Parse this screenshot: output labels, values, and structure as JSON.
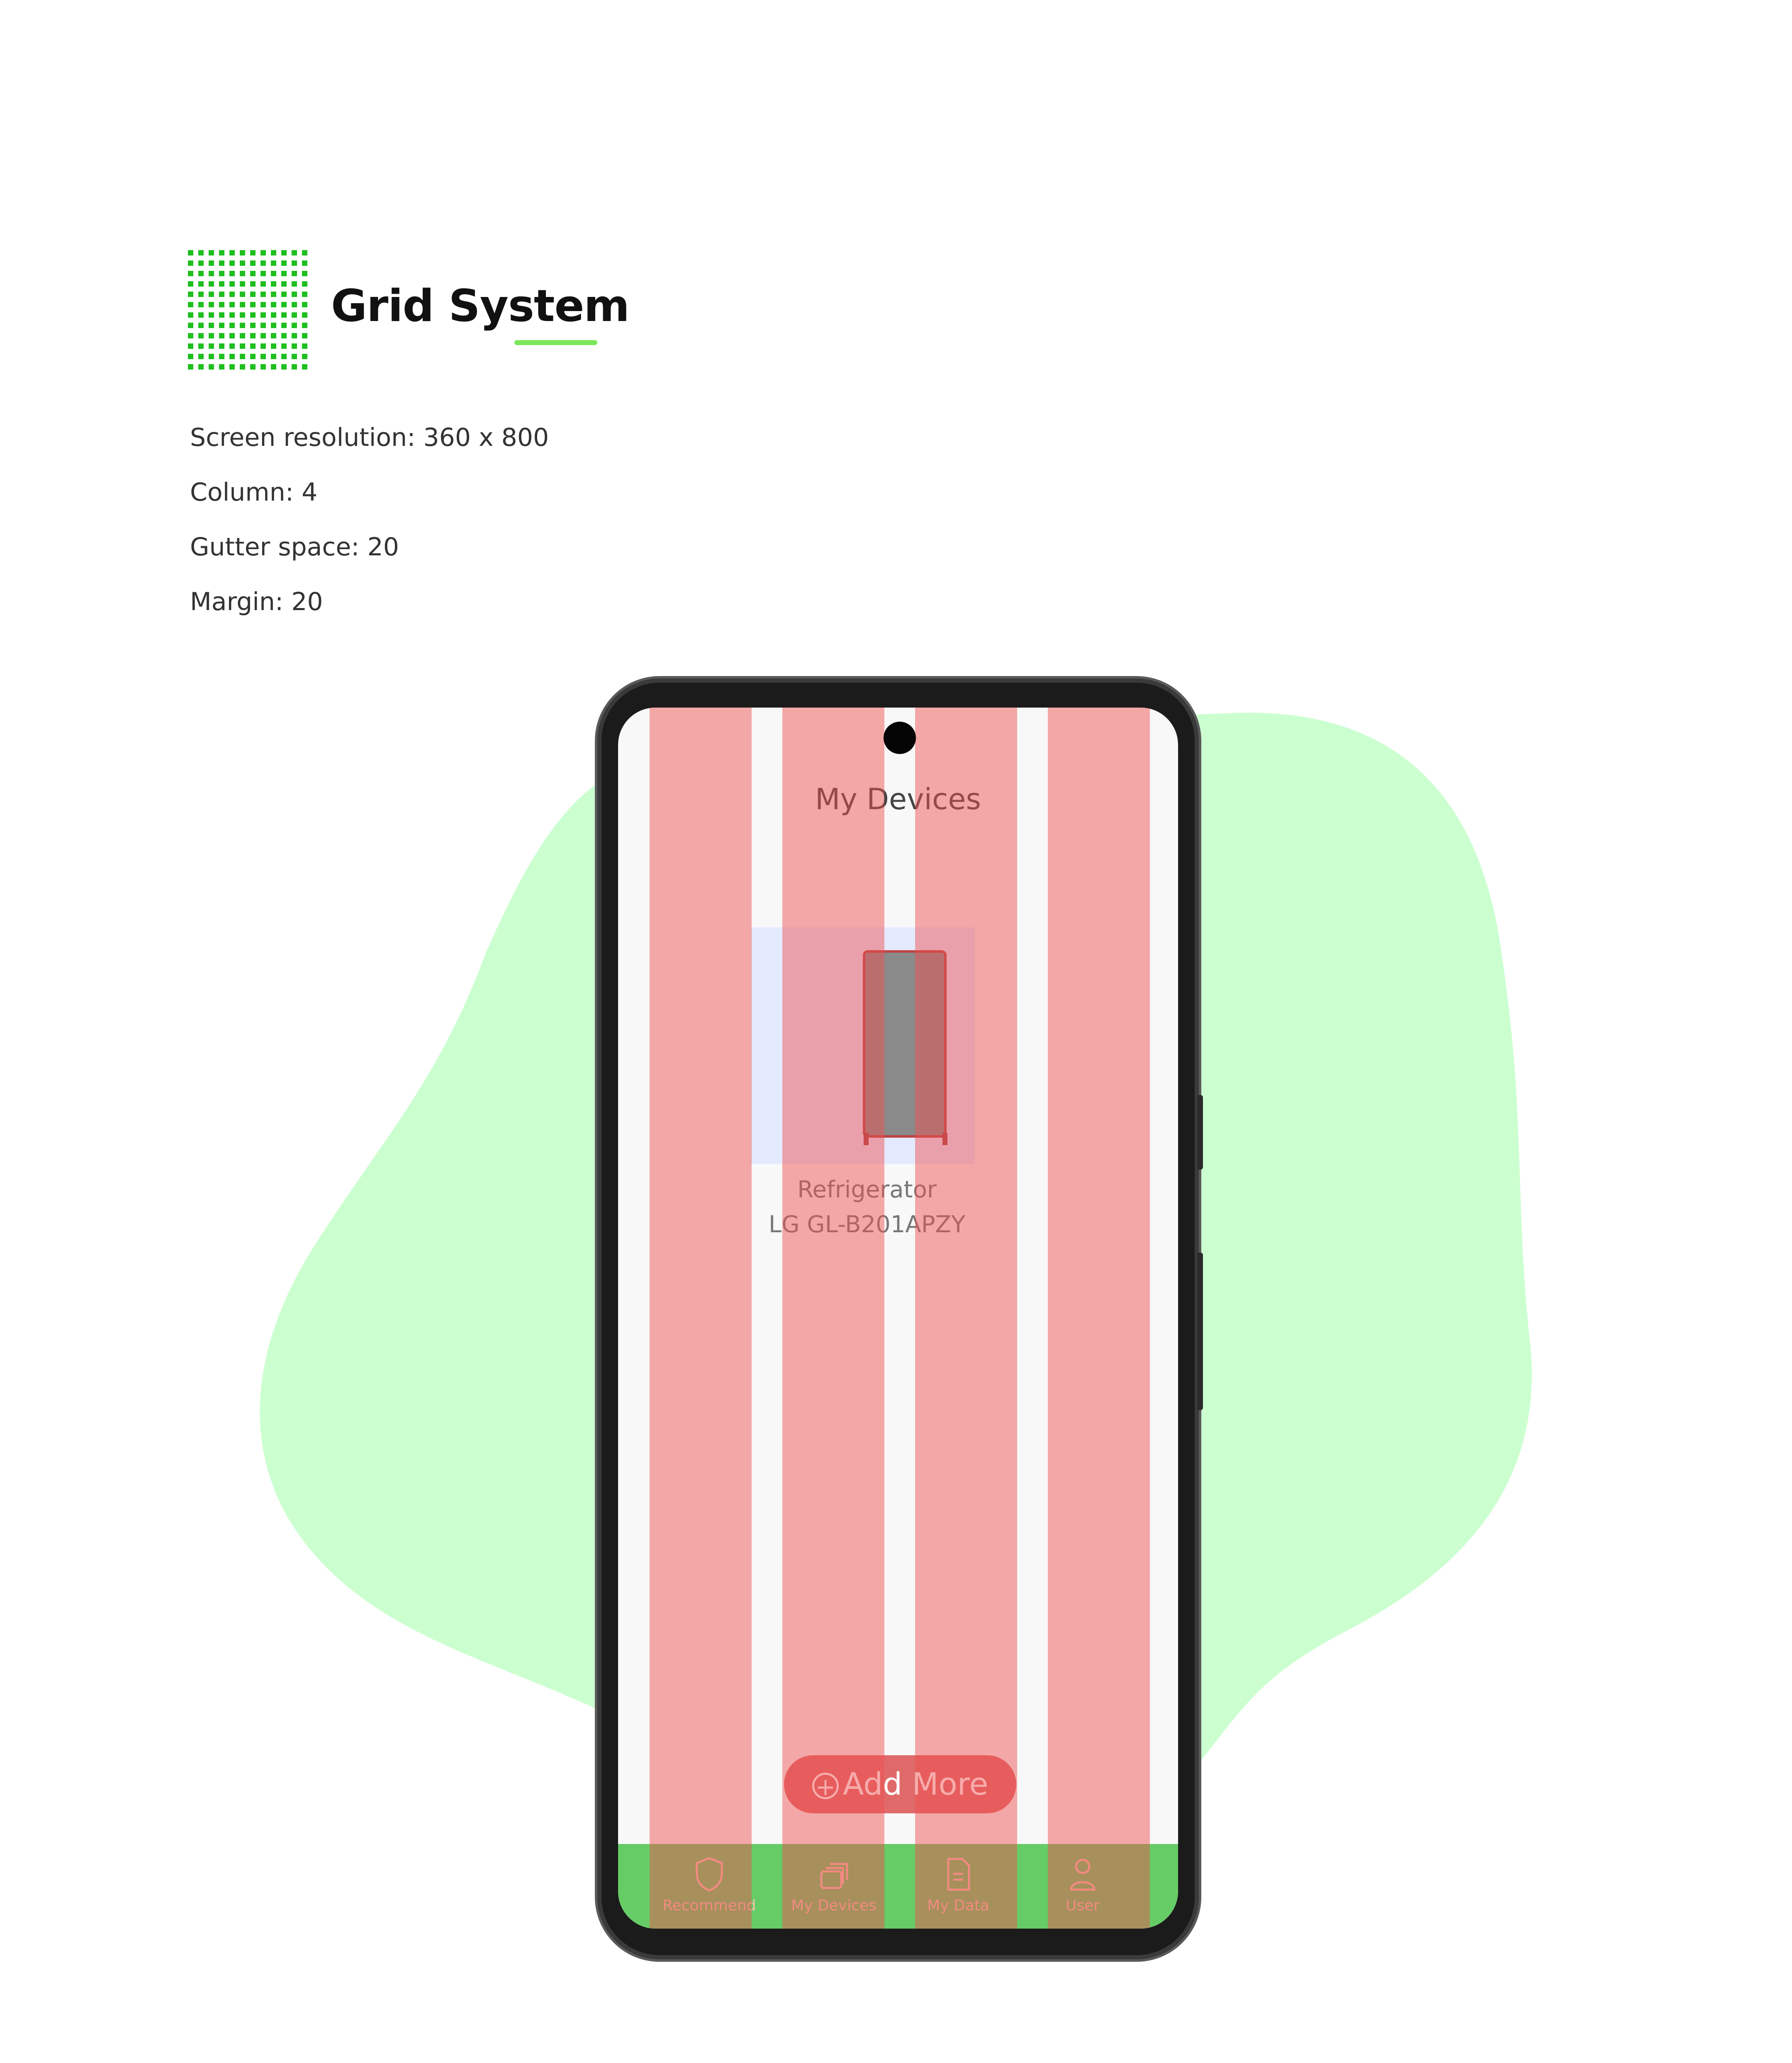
{
  "header": {
    "title": "Grid System",
    "accent_color": "#1fbf1f",
    "underline_color": "#7be85a"
  },
  "specs": {
    "resolution": "Screen resolution: 360 x 800",
    "columns": "Column: 4",
    "gutter": "Gutter space: 20",
    "margin": "Margin: 20"
  },
  "screen": {
    "title": "My Devices",
    "device": {
      "name": "Refrigerator",
      "model": "LG GL-B201APZY",
      "icon": "refrigerator-image"
    },
    "add_more_label": "Add More",
    "add_more_icon": "plus-circle-icon",
    "nav": [
      {
        "label": "Recommend",
        "icon": "shield-icon"
      },
      {
        "label": "My Devices",
        "icon": "devices-icon"
      },
      {
        "label": "My Data",
        "icon": "document-icon"
      },
      {
        "label": "User",
        "icon": "user-icon"
      }
    ]
  },
  "colors": {
    "blob": "#ccffd0",
    "grid_column": "#ef5050",
    "nav_bar": "#66cc66"
  }
}
